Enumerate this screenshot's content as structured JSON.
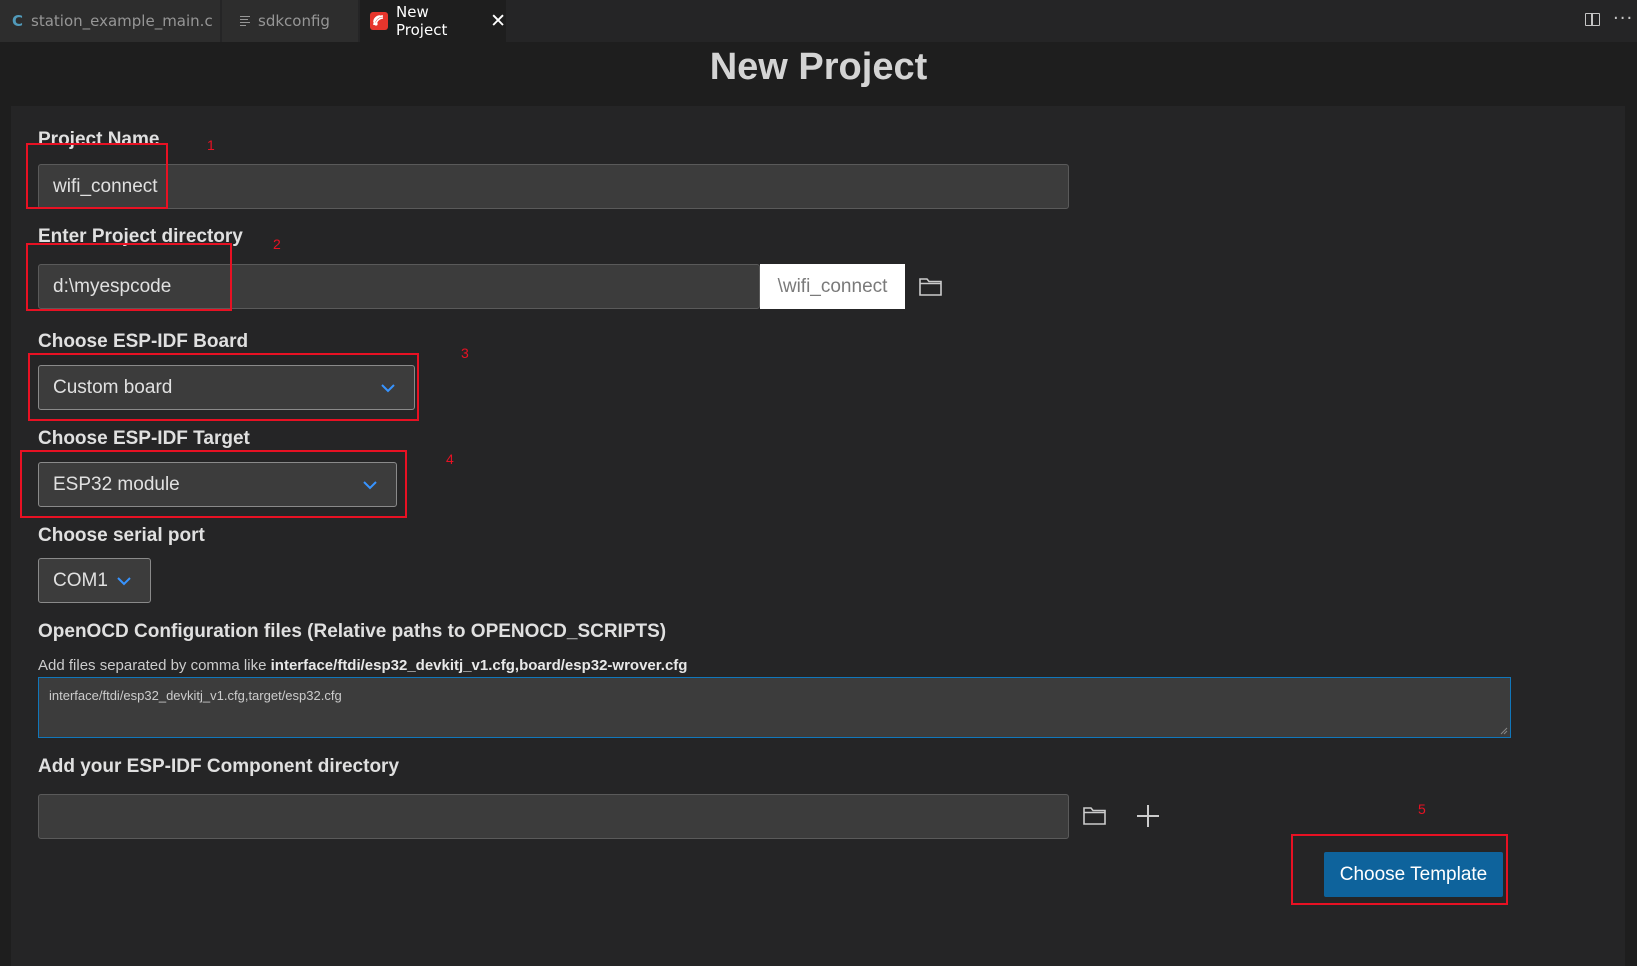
{
  "tabs": [
    {
      "label": "station_example_main.c",
      "icon": "c-file-icon"
    },
    {
      "label": "sdkconfig",
      "icon": "config-file-icon"
    },
    {
      "label": "New Project",
      "icon": "espressif-icon",
      "active": true
    }
  ],
  "page_title": "New Project",
  "form": {
    "project_name": {
      "label": "Project Name",
      "value": "wifi_connect"
    },
    "project_dir": {
      "label": "Enter Project directory",
      "value": "d:\\myespcode",
      "suffix": "\\wifi_connect"
    },
    "board": {
      "label": "Choose ESP-IDF Board",
      "selected": "Custom board"
    },
    "target": {
      "label": "Choose ESP-IDF Target",
      "selected": "ESP32 module"
    },
    "serial_port": {
      "label": "Choose serial port",
      "selected": "COM1"
    },
    "openocd": {
      "label": "OpenOCD Configuration files (Relative paths to OPENOCD_SCRIPTS)",
      "hint_prefix": "Add files separated by comma like ",
      "hint_example": "interface/ftdi/esp32_devkitj_v1.cfg,board/esp32-wrover.cfg",
      "value": "interface/ftdi/esp32_devkitj_v1.cfg,target/esp32.cfg"
    },
    "components": {
      "label": "Add your ESP-IDF Component directory",
      "value": ""
    },
    "choose_template_button": "Choose Template"
  },
  "annotations": [
    "1",
    "2",
    "3",
    "4",
    "5"
  ],
  "colors": {
    "accent": "#0e639c",
    "annotation": "#e81123",
    "chevron": "#3794ff"
  }
}
